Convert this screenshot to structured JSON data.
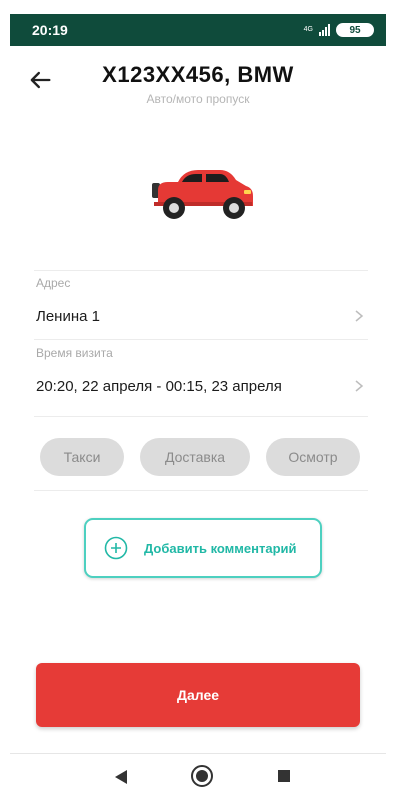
{
  "status_bar": {
    "time": "20:19",
    "network": "4G",
    "battery": "95"
  },
  "header": {
    "title": "X123XX456, BMW",
    "subtitle": "Авто/мото пропуск"
  },
  "icons": {
    "car": "car-icon",
    "back": "arrow-left-icon"
  },
  "fields": {
    "address_label": "Адрес",
    "address_value": "Ленина 1",
    "time_label": "Время визита",
    "time_value": "20:20, 22 апреля - 00:15, 23 апреля"
  },
  "chips": [
    "Такси",
    "Доставка",
    "Осмотр"
  ],
  "comment_button": {
    "label": "Добавить комментарий"
  },
  "next_button": {
    "label": "Далее"
  },
  "colors": {
    "accent": "#4dd0c0",
    "primary": "#e63b37",
    "status_bar": "#0f4b3b",
    "car": "#e53935"
  }
}
